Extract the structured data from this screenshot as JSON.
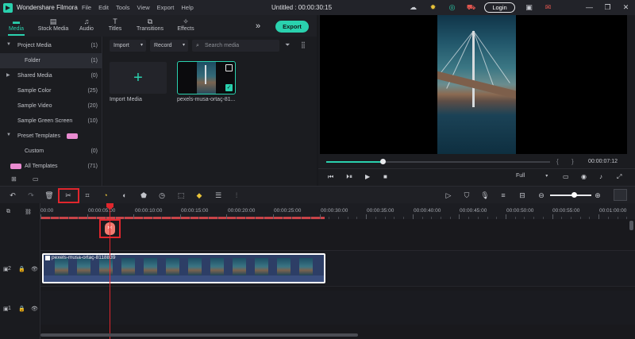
{
  "titlebar": {
    "app_name": "Wondershare Filmora",
    "menu": [
      "File",
      "Edit",
      "Tools",
      "View",
      "Export",
      "Help"
    ],
    "doc_title": "Untitled : 00:00:30:15",
    "login_label": "Login",
    "icons": [
      "cloud-icon",
      "bulb-icon",
      "support-icon",
      "cart-icon",
      "save-icon",
      "mail-icon",
      "minimize-icon",
      "maximize-icon",
      "close-icon"
    ]
  },
  "media_tabs": [
    {
      "label": "Media",
      "icon": "folder-icon",
      "active": true
    },
    {
      "label": "Stock Media",
      "icon": "stock-icon",
      "active": false
    },
    {
      "label": "Audio",
      "icon": "music-icon",
      "active": false
    },
    {
      "label": "Titles",
      "icon": "titles-icon",
      "active": false
    },
    {
      "label": "Transitions",
      "icon": "transitions-icon",
      "active": false
    },
    {
      "label": "Effects",
      "icon": "effects-icon",
      "active": false
    }
  ],
  "export_label": "Export",
  "sidebar": {
    "items": [
      {
        "label": "Project Media",
        "count": "(1)",
        "expandable": true
      },
      {
        "label": "Folder",
        "count": "(1)",
        "selected": true
      },
      {
        "label": "Shared Media",
        "count": "(0)",
        "expandable": true
      },
      {
        "label": "Sample Color",
        "count": "(25)"
      },
      {
        "label": "Sample Video",
        "count": "(20)"
      },
      {
        "label": "Sample Green Screen",
        "count": "(10)"
      },
      {
        "label": "Preset Templates",
        "count": "",
        "expandable": true,
        "badge": true
      },
      {
        "label": "Custom",
        "count": "(0)"
      },
      {
        "label": "All Templates",
        "count": "(71)",
        "badge": true
      }
    ]
  },
  "library": {
    "import_filter": "Import",
    "record_filter": "Record",
    "search_placeholder": "Search media",
    "import_tile_label": "Import Media",
    "clip_label": "pexels-musa-ortaç-81..."
  },
  "preview": {
    "time": "00:00:07:12",
    "quality": "Full",
    "progress": 0.25
  },
  "timeline": {
    "ruler_labels": [
      "00:00",
      "00:00:05:00",
      "00:00:10:00",
      "00:00:15:00",
      "00:00:20:00",
      "00:00:25:00",
      "00:00:30:00",
      "00:00:35:00",
      "00:00:40:00",
      "00:00:45:00",
      "00:00:50:00",
      "00:00:55:00",
      "00:01:00:00"
    ],
    "clip_name": "pexels-musa-ortaç-8118839",
    "track_labels": [
      "2",
      "1"
    ],
    "zoom_level": 0.55
  },
  "colors": {
    "accent": "#2ad1ae",
    "highlight": "#e0262d",
    "clip": "#2d3e66"
  }
}
